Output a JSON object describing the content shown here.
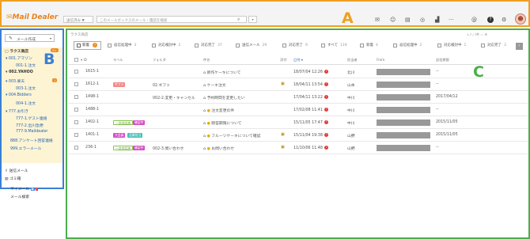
{
  "header": {
    "logo_prefix": "✉",
    "logo_text": "Mail Dealer",
    "select_text": "送信済み ▼",
    "search_placeholder": "このメールボックスのメール・電話を検索",
    "marker": "A",
    "icons": [
      "mail-icon",
      "smile-icon",
      "document-icon",
      "chat-icon",
      "chart-icon",
      "more-icon",
      "at-icon",
      "help-icon",
      "gear-icon"
    ],
    "icon_glyphs": [
      "✉",
      "☺",
      "▤",
      "◎",
      "▟",
      "···",
      "@",
      "?",
      "⚙"
    ],
    "avatar_glyph": "☻"
  },
  "sidebar": {
    "mail_button": "メール作成",
    "marker": "B",
    "tree": [
      {
        "label": "ラクス商店",
        "badge": "5+",
        "bold": true
      },
      {
        "label": "▾ 001.アマゾン",
        "badge": "2"
      },
      {
        "label": "001-1.注文"
      },
      {
        "label": "▾ 002.YAHOO",
        "badge": "2",
        "bold": true
      },
      {
        "label": "▾ 003.楽天",
        "badge": "1"
      },
      {
        "label": "003-1.注文"
      },
      {
        "label": "▾ 004.Bidders"
      },
      {
        "label": "004-1.注文"
      },
      {
        "label": "▾ 777.お引き"
      },
      {
        "label": "777-1.ゲスト連絡"
      },
      {
        "label": "777-2.出川急便"
      },
      {
        "label": "777-9.Maildealer"
      },
      {
        "label": "888.アンケート回答連絡"
      },
      {
        "label": "999.エラーメール"
      }
    ],
    "extra": [
      "送信メール",
      "ゴミ箱",
      "マイメール",
      "メール検索"
    ]
  },
  "main": {
    "breadcrumb": "ラクス商店",
    "page_info": "1-7 / 7件 ‹ › ☰",
    "marker": "C",
    "tabs": [
      {
        "label": "新着",
        "count": "7"
      },
      {
        "label": "返信処理中",
        "count": "3"
      },
      {
        "label": "対応検討中",
        "count": "2"
      },
      {
        "label": "対応完了",
        "count": "37"
      },
      {
        "label": "送信メール",
        "count": "29"
      },
      {
        "label": "対応完了",
        "count": "9"
      },
      {
        "label": "すべて",
        "count": "119"
      },
      {
        "label": "新着",
        "count": "4"
      },
      {
        "label": "返信処理中",
        "count": "2"
      },
      {
        "label": "対応検討中",
        "count": "1"
      },
      {
        "label": "対応完了",
        "count": "3"
      }
    ],
    "next_label": "›",
    "columns": [
      "ID",
      "ラベル",
      "フォルダ",
      "件名",
      "添付",
      "日付 ▾",
      "担当者",
      "From",
      "返信期限"
    ],
    "rows": [
      {
        "id": "1615-1",
        "label": "",
        "label2": "",
        "folder": "",
        "subject": "新作ケーキについて",
        "clip": false,
        "date": "18/07/04 12:26",
        "alert": "!",
        "owner": "北川",
        "deadline": "--"
      },
      {
        "id": "1612-1",
        "label": "ギフト",
        "label2": "",
        "folder": "02.ギフト",
        "subject": "ケーキ注文",
        "clip": true,
        "date": "18/04/11 13:54",
        "alert": "!",
        "owner": "山本",
        "deadline": "--"
      },
      {
        "id": "1498-1",
        "label": "",
        "label2": "",
        "folder": "002-2.変更・キャンセル",
        "subject": "予約時間を変更したい",
        "clip": false,
        "date": "17/04/11 13:22",
        "alert": "!",
        "owner": "中川",
        "deadline": "2017/04/12"
      },
      {
        "id": "1488-1",
        "label": "",
        "label2": "",
        "folder": "",
        "subject": "注文変更の件",
        "clip": false,
        "date": "17/02/08 11:41",
        "alert": "!",
        "owner": "中川",
        "deadline": "--"
      },
      {
        "id": "1402-1",
        "label": "一次対応済",
        "label2": "確認中",
        "folder": "",
        "subject": "贈答期限について",
        "clip": false,
        "date": "15/11/05 17:47",
        "alert": "!",
        "owner": "中川",
        "deadline": "2015/11/05"
      },
      {
        "id": "1401-1",
        "label": "大会員",
        "label2": "品質担当",
        "folder": "",
        "subject": "フルーツケーキについて確認",
        "clip": true,
        "date": "15/11/04 19:38",
        "alert": "!",
        "owner": "山野",
        "deadline": "2015/11/05"
      },
      {
        "id": "236-1",
        "label": "一次対応済",
        "label2": "確認中",
        "folder": "002-3.問い合わせ",
        "subject": "お問い合わせ",
        "clip": true,
        "date": "11/10/06 11:48",
        "alert": "!",
        "owner": "山野",
        "deadline": "--"
      }
    ]
  },
  "colors": {
    "orange": "#f0a020",
    "blue": "#3a7fd5",
    "green": "#4cae4c",
    "label_pink": "#f48a8a",
    "label_green": "#8ac24a",
    "label_magenta": "#d64ec6",
    "label_teal": "#41c1b7"
  }
}
